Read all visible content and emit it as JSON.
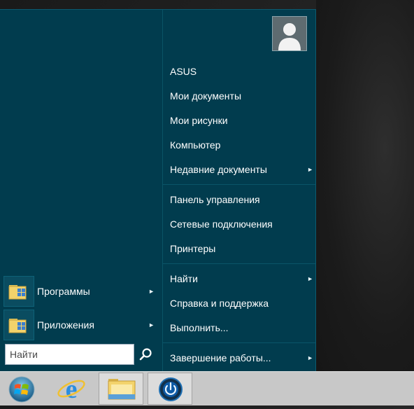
{
  "start_menu": {
    "user": {
      "name": "ASUS"
    },
    "right_items": [
      {
        "label": "ASUS",
        "has_submenu": false
      },
      {
        "label": "Мои документы",
        "has_submenu": false
      },
      {
        "label": "Мои рисунки",
        "has_submenu": false
      },
      {
        "label": "Компьютер",
        "has_submenu": false
      },
      {
        "label": "Недавние документы",
        "has_submenu": true
      },
      {
        "label": "Панель управления",
        "has_submenu": false
      },
      {
        "label": "Сетевые подключения",
        "has_submenu": false
      },
      {
        "label": "Принтеры",
        "has_submenu": false
      },
      {
        "label": "Найти",
        "has_submenu": true
      },
      {
        "label": "Справка и поддержка",
        "has_submenu": false
      },
      {
        "label": "Выполнить...",
        "has_submenu": false
      },
      {
        "label": "Завершение работы...",
        "has_submenu": true
      }
    ],
    "left_items": [
      {
        "label": "Программы",
        "icon": "programs-folder-icon",
        "has_submenu": true
      },
      {
        "label": "Приложения",
        "icon": "apps-folder-icon",
        "has_submenu": true
      }
    ],
    "search": {
      "placeholder": "Найти",
      "icon": "magnifier-icon"
    },
    "submenu_arrow": "►"
  },
  "taskbar": {
    "buttons": [
      {
        "name": "start-orb",
        "icon": "start-orb-icon"
      },
      {
        "name": "internet-explorer",
        "icon": "ie-icon"
      },
      {
        "name": "file-explorer",
        "icon": "folder-icon",
        "active": true
      },
      {
        "name": "power-app",
        "icon": "power-icon",
        "active": true
      }
    ]
  },
  "colors": {
    "menu_bg": "#013c4e",
    "taskbar_bg": "#c8c8c8",
    "text": "#ffffff"
  }
}
